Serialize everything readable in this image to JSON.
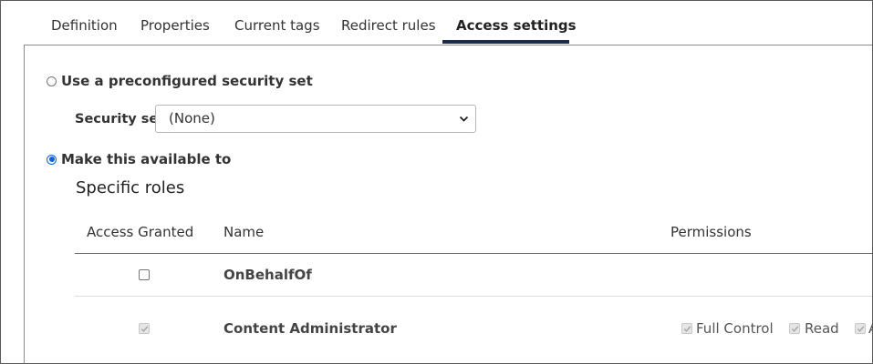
{
  "tabs": [
    {
      "label": "Definition"
    },
    {
      "label": "Properties"
    },
    {
      "label": "Current tags"
    },
    {
      "label": "Redirect rules"
    },
    {
      "label": "Access settings",
      "active": true
    }
  ],
  "access": {
    "preconfigured_label": "Use a preconfigured security set",
    "security_set_label": "Security set",
    "security_set_value": "(None)",
    "make_available_label": "Make this available to",
    "selected_option": "Make this available to"
  },
  "roles": {
    "title": "Specific roles",
    "columns": {
      "access_granted": "Access Granted",
      "name": "Name",
      "permissions": "Permissions"
    },
    "rows": [
      {
        "name": "OnBehalfOf",
        "granted": false,
        "disabled": false,
        "permissions": []
      },
      {
        "name": "Content Administrator",
        "granted": true,
        "disabled": true,
        "permissions": [
          {
            "label": "Full Control",
            "checked": true
          },
          {
            "label": "Read",
            "checked": true
          },
          {
            "label": "A",
            "checked": true
          }
        ]
      }
    ]
  },
  "colors": {
    "accent": "#1c2b4a",
    "radio_selected": "#0b62d6",
    "border": "#8c8c8c"
  }
}
